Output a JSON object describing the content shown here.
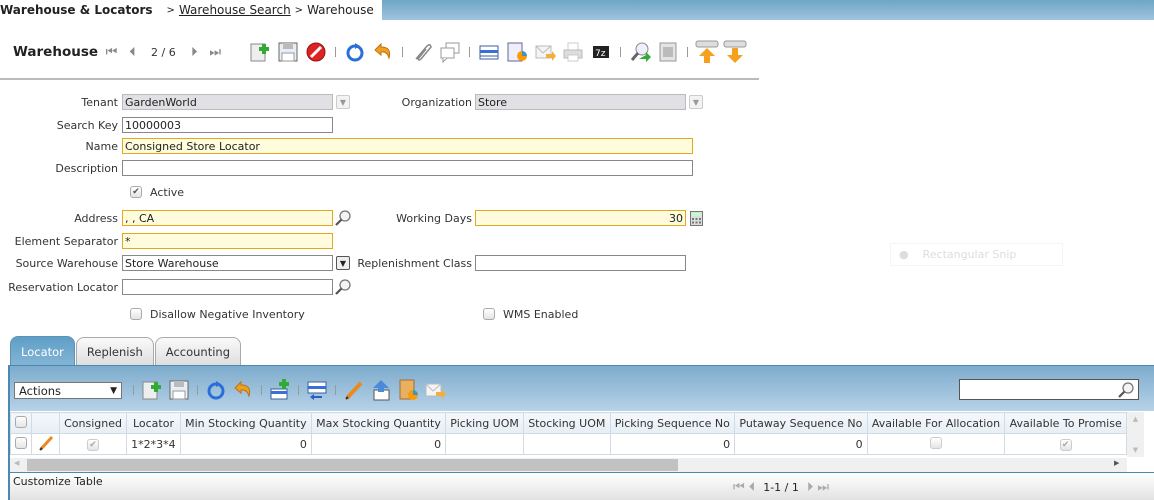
{
  "breadcrumb": {
    "root": "Warehouse & Locators",
    "separator": ">",
    "link": "Warehouse Search",
    "current": "Warehouse"
  },
  "header": {
    "title": "Warehouse",
    "record_position": "2 / 6"
  },
  "toolbar": {
    "icons": [
      "new-record-icon",
      "save-icon",
      "delete-icon",
      "refresh-icon",
      "undo-icon",
      "attachment-icon",
      "chat-icon",
      "grid-toggle-icon",
      "report-chart-icon",
      "email-icon",
      "print-icon",
      "zip-export-icon",
      "zoom-across-icon",
      "archive-report-icon",
      "parent-record-icon",
      "detail-record-icon"
    ]
  },
  "form": {
    "tenant": {
      "label": "Tenant",
      "value": "GardenWorld"
    },
    "organization": {
      "label": "Organization",
      "value": "Store"
    },
    "search_key": {
      "label": "Search Key",
      "value": "10000003"
    },
    "name": {
      "label": "Name",
      "value": "Consigned Store Locator"
    },
    "description": {
      "label": "Description",
      "value": ""
    },
    "active": {
      "label": "Active",
      "checked": true
    },
    "address": {
      "label": "Address",
      "value": ", , CA"
    },
    "working_days": {
      "label": "Working Days",
      "value": "30"
    },
    "element_separator": {
      "label": "Element Separator",
      "value": "*"
    },
    "source_warehouse": {
      "label": "Source Warehouse",
      "value": "Store Warehouse"
    },
    "replenishment_class": {
      "label": "Replenishment Class",
      "value": ""
    },
    "reservation_locator": {
      "label": "Reservation Locator",
      "value": ""
    },
    "disallow_negative": {
      "label": "Disallow Negative Inventory",
      "checked": false
    },
    "wms_enabled": {
      "label": "WMS Enabled",
      "checked": false
    }
  },
  "overlay": {
    "snip_label": "Rectangular Snip"
  },
  "tabs": [
    {
      "label": "Locator",
      "active": true
    },
    {
      "label": "Replenish",
      "active": false
    },
    {
      "label": "Accounting",
      "active": false
    }
  ],
  "grid_toolbar": {
    "actions_label": "Actions",
    "search_placeholder": ""
  },
  "grid": {
    "columns": [
      "",
      "",
      "Consigned",
      "Locator",
      "Min Stocking Quantity",
      "Max Stocking Quantity",
      "Picking UOM",
      "Stocking UOM",
      "Picking Sequence No",
      "Putaway Sequence No",
      "Available For Allocation",
      "Available To Promise"
    ],
    "rows": [
      {
        "consigned": true,
        "locator": "1*2*3*4",
        "min_qty": "0",
        "max_qty": "0",
        "picking_uom": "",
        "stocking_uom": "",
        "picking_seq": "0",
        "putaway_seq": "0",
        "avail_allocation": false,
        "avail_promise": true
      }
    ]
  },
  "footer": {
    "customize_label": "Customize Table",
    "pager_text": "1-1 / 1"
  }
}
